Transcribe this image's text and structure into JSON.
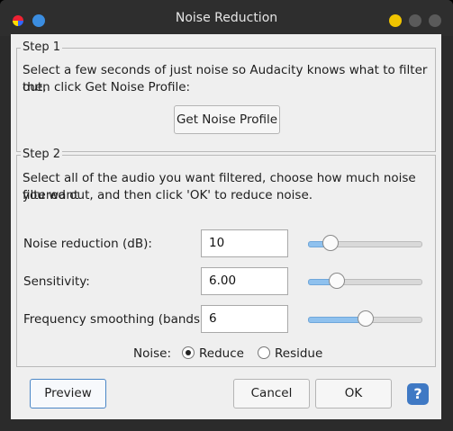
{
  "window": {
    "title": "Noise Reduction"
  },
  "step1": {
    "legend": "Step 1",
    "description_line1": "Select a few seconds of just noise so Audacity knows what to filter out,",
    "description_line2": "then click Get Noise Profile:",
    "button_label": "Get Noise Profile"
  },
  "step2": {
    "legend": "Step 2",
    "description_line1": "Select all of the audio you want filtered, choose how much noise you want",
    "description_line2": "filtered out, and then click 'OK' to reduce noise.",
    "params": [
      {
        "label": "Noise reduction (dB):",
        "value": "10",
        "slider_fraction": 0.2
      },
      {
        "label": "Sensitivity:",
        "value": "6.00",
        "slider_fraction": 0.25
      },
      {
        "label": "Frequency smoothing (bands):",
        "value": "6",
        "slider_fraction": 0.5
      }
    ],
    "noise_label": "Noise:",
    "noise_options": [
      {
        "label": "Reduce",
        "selected": true
      },
      {
        "label": "Residue",
        "selected": false
      }
    ]
  },
  "footer": {
    "preview_label": "Preview",
    "cancel_label": "Cancel",
    "ok_label": "OK",
    "help_label": "?"
  },
  "colors": {
    "accent": "#3f79c4",
    "slider_fill": "#8fc1ee"
  }
}
